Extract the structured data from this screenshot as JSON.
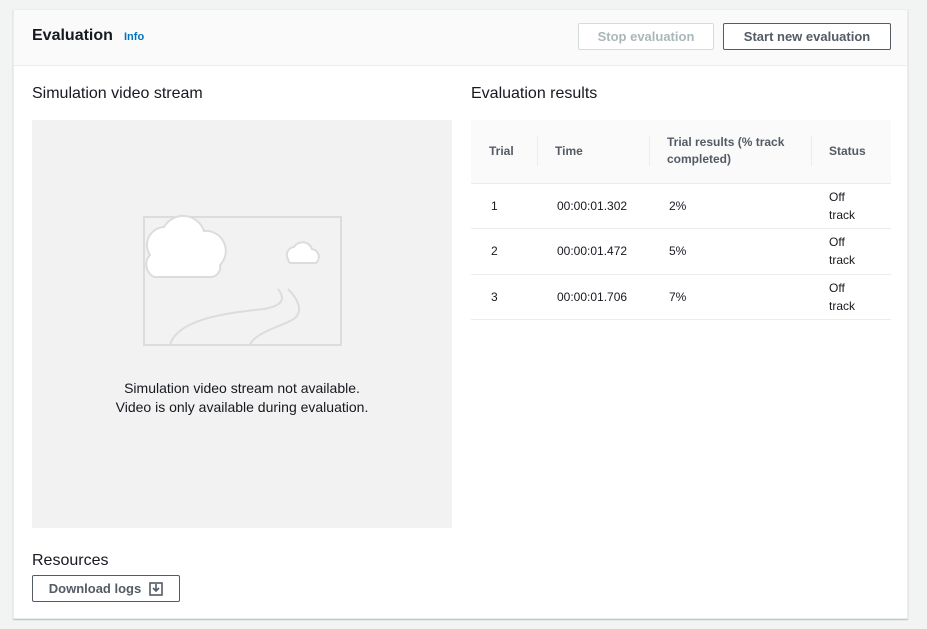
{
  "header": {
    "title": "Evaluation",
    "info_label": "Info",
    "stop_button": "Stop evaluation",
    "start_button": "Start new evaluation"
  },
  "video": {
    "title": "Simulation video stream",
    "message_line1": "Simulation video stream not available.",
    "message_line2": "Video is only available during evaluation."
  },
  "results": {
    "title": "Evaluation results",
    "columns": [
      "Trial",
      "Time",
      "Trial results (% track completed)",
      "Status"
    ],
    "rows": [
      {
        "trial": "1",
        "time": "00:00:01.302",
        "result": "2%",
        "status_line1": "Off",
        "status_line2": "track"
      },
      {
        "trial": "2",
        "time": "00:00:01.472",
        "result": "5%",
        "status_line1": "Off",
        "status_line2": "track"
      },
      {
        "trial": "3",
        "time": "00:00:01.706",
        "result": "7%",
        "status_line1": "Off",
        "status_line2": "track"
      }
    ]
  },
  "resources": {
    "title": "Resources",
    "download_button": "Download logs",
    "download_icon": "download-icon"
  },
  "colors": {
    "link": "#0073bb",
    "primary_text": "#16191f",
    "secondary_text": "#545b64",
    "disabled_text": "#aab7b8",
    "placeholder_bg": "#f2f2f2"
  }
}
